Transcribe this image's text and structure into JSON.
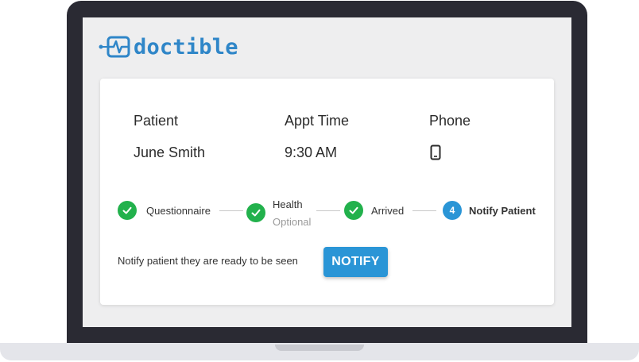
{
  "app": {
    "logo_text": "doctible"
  },
  "table": {
    "headers": {
      "patient": "Patient",
      "appt_time": "Appt Time",
      "phone": "Phone"
    },
    "row": {
      "patient": "June Smith",
      "appt_time": "9:30 AM",
      "phone_icon": "mobile-phone-icon"
    }
  },
  "steps": [
    {
      "label": "Questionnaire",
      "status": "complete"
    },
    {
      "label": "Health",
      "sublabel": "Optional",
      "status": "complete"
    },
    {
      "label": "Arrived",
      "status": "complete"
    },
    {
      "label": "Notify Patient",
      "number": "4",
      "status": "current"
    }
  ],
  "notify": {
    "message": "Notify patient they are ready to be seen",
    "button_label": "NOTIFY"
  },
  "colors": {
    "brand": "#2f86c8",
    "complete": "#22b14c",
    "accent": "#2a95d6",
    "bezel": "#2a2a33"
  }
}
